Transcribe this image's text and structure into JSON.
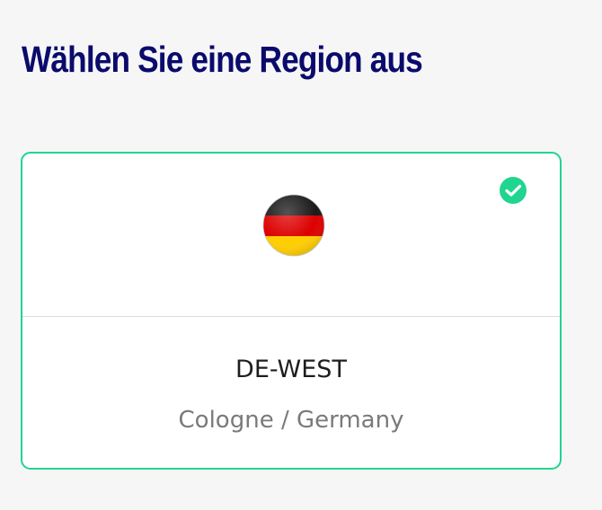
{
  "page": {
    "title": "Wählen Sie eine Region aus"
  },
  "region_card": {
    "code": "DE-WEST",
    "location": "Cologne / Germany",
    "flag_icon": "germany-flag-icon",
    "selected": true,
    "selected_icon": "check-circle-icon"
  },
  "colors": {
    "title": "#0a0b6b",
    "selected_border": "#20d58f",
    "check": "#20d58f",
    "background": "#f6f6f7",
    "flag_black": "#1a1a1a",
    "flag_red": "#dd0000",
    "flag_gold": "#ffce00"
  }
}
